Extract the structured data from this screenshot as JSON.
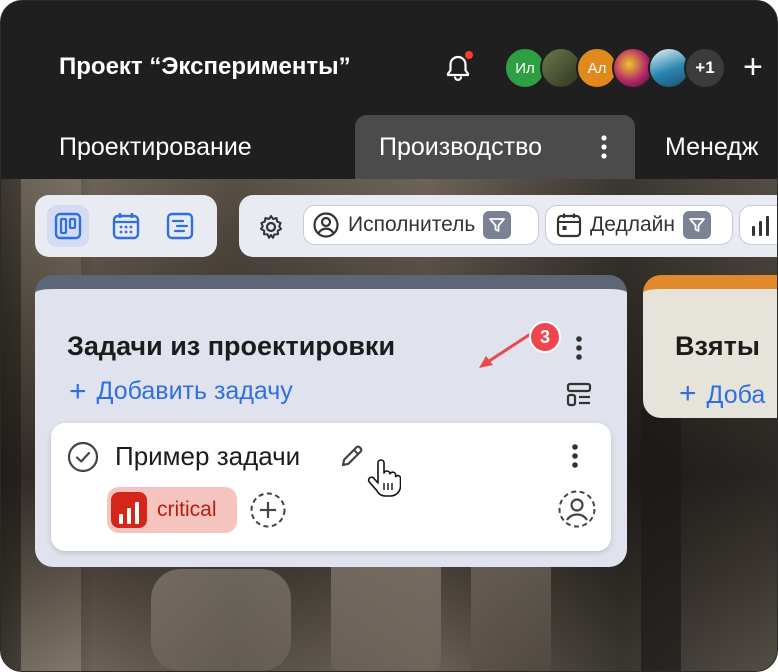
{
  "header": {
    "project_title": "Проект “Эксперименты”",
    "avatars": [
      {
        "initials": "Ил",
        "color": "#2ea043"
      },
      {
        "initials": "",
        "color": "#4a5a3a"
      },
      {
        "initials": "Ал",
        "color": "#e08a1e"
      },
      {
        "initials": "",
        "color": "#8a2a6a"
      },
      {
        "initials": "",
        "color": "#2a7a9a"
      }
    ],
    "more_count": "+1",
    "add_label": "+"
  },
  "tabs": [
    {
      "label": "Проектирование",
      "active": false
    },
    {
      "label": "Производство",
      "active": true
    },
    {
      "label": "Менедж",
      "active": false
    }
  ],
  "toolbar": {
    "views": [
      "board-icon",
      "calendar-icon",
      "timeline-icon"
    ],
    "filters": [
      {
        "label": "Исполнитель",
        "icon": "person-icon"
      },
      {
        "label": "Дедлайн",
        "icon": "calendar-icon"
      }
    ]
  },
  "columns": [
    {
      "title": "Задачи из проектировки",
      "accent": "#5d6678",
      "add_task": "Добавить задачу",
      "badge": "3",
      "cards": [
        {
          "title": "Пример задачи",
          "tag": "critical",
          "tag_color": "#d42619"
        }
      ]
    },
    {
      "title": "Взяты",
      "accent": "#e08a2b",
      "add_task": "Доба"
    }
  ]
}
